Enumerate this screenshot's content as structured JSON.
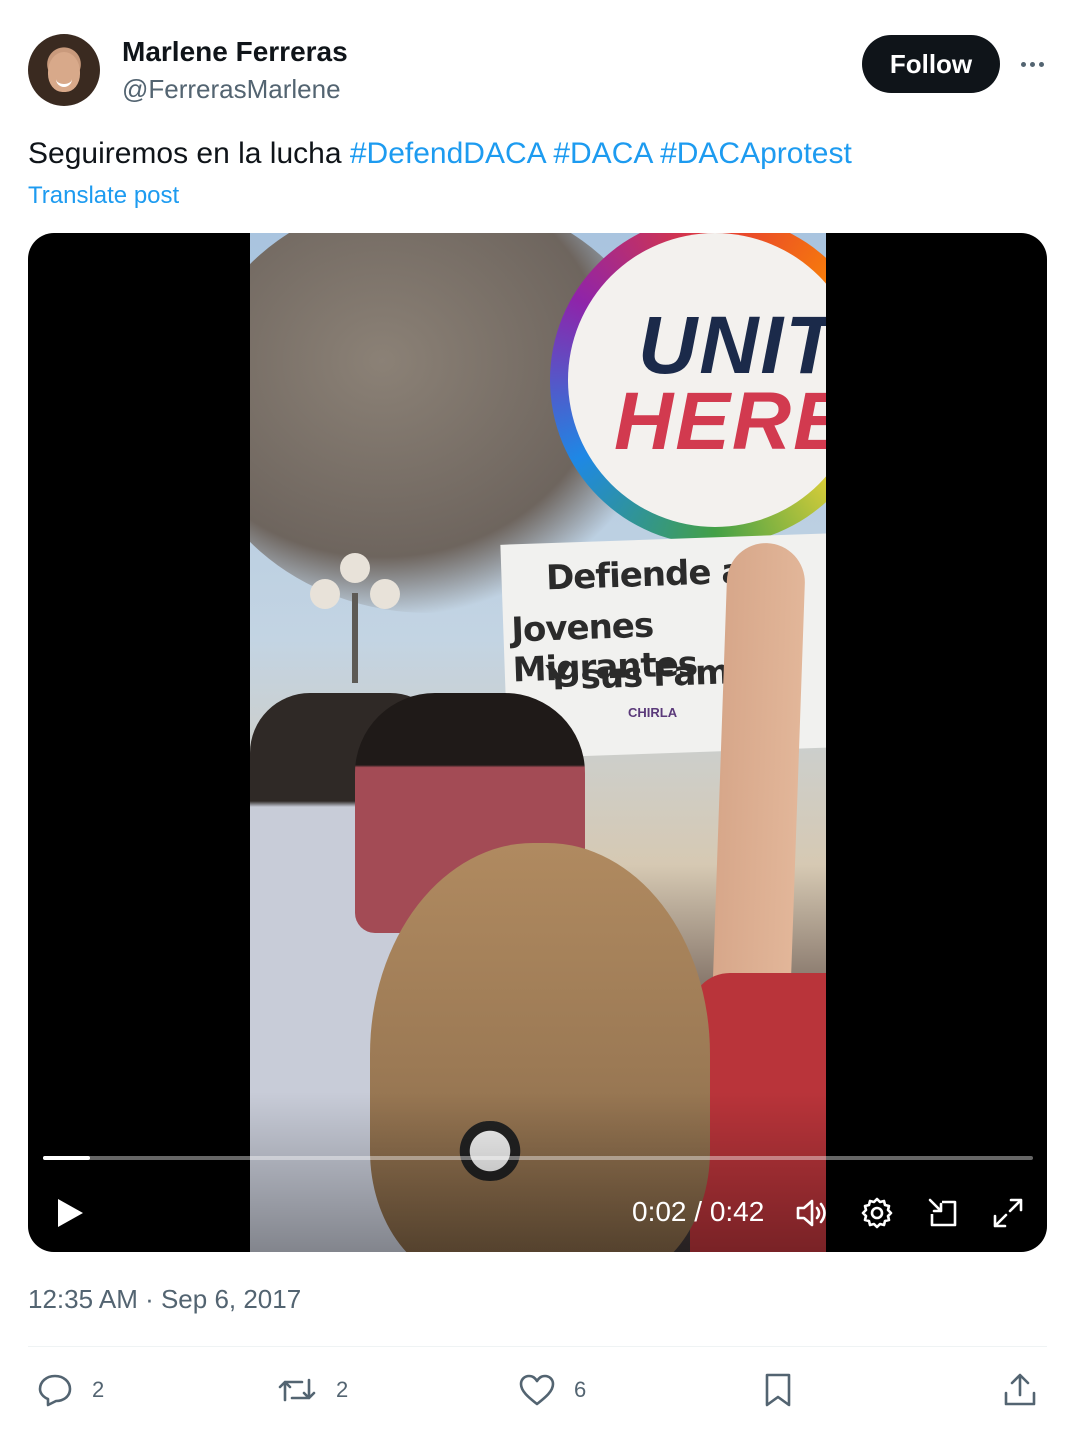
{
  "author": {
    "name": "Marlene Ferreras",
    "handle": "@FerrerasMarlene"
  },
  "follow_label": "Follow",
  "post": {
    "text": "Seguiremos en la lucha ",
    "hashtags": [
      "#DefendDACA",
      "#DACA",
      "#DACAprotest"
    ],
    "translate_label": "Translate post"
  },
  "video": {
    "sign_line1": "UNIT",
    "sign_line2": "HERE",
    "board_lines": [
      "Defiende a",
      "Jovenes Migrantes",
      "Y sus Famili"
    ],
    "board_logo": "CHIRLA",
    "current_time": "0:02",
    "duration": "0:42",
    "time_display": "0:02 / 0:42",
    "progress_fraction": 0.047
  },
  "timestamp": "12:35 AM · Sep 6, 2017",
  "actions": {
    "replies": "2",
    "reposts": "2",
    "likes": "6"
  },
  "colors": {
    "link": "#1d9bf0",
    "text": "#0f1419",
    "muted": "#536471"
  }
}
